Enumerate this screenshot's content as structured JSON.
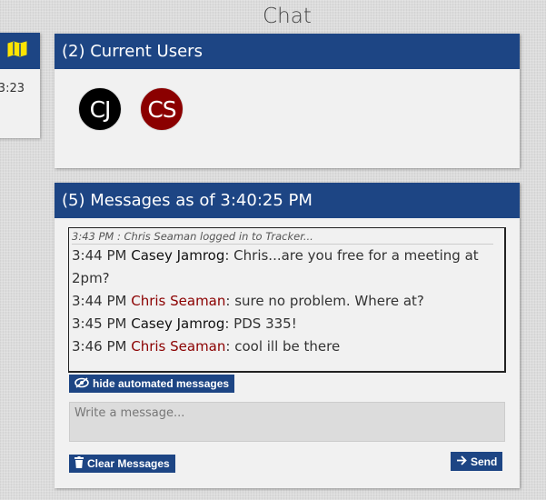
{
  "page": {
    "title": "Chat"
  },
  "left_panel": {
    "time": "3:23",
    "icon": "map-icon"
  },
  "users": {
    "header": "(2) Current Users",
    "list": [
      {
        "initials": "CJ",
        "color": "#000000"
      },
      {
        "initials": "CS",
        "color": "#8b0000"
      }
    ]
  },
  "messages": {
    "header": "(5) Messages as of 3:40:25 PM",
    "automated": "3:43 PM : Chris Seaman logged in to Tracker...",
    "items": [
      {
        "time": "3:44 PM",
        "user": "Casey Jamrog",
        "text": ": Chris...are you free for a meeting at 2pm?",
        "user_color": "#111111"
      },
      {
        "time": "3:44 PM",
        "user": "Chris Seaman",
        "text": ": sure no problem. Where at?",
        "user_color": "#8b0000"
      },
      {
        "time": "3:45 PM",
        "user": "Casey Jamrog",
        "text": ": PDS 335!",
        "user_color": "#111111"
      },
      {
        "time": "3:46 PM",
        "user": "Chris Seaman",
        "text": ": cool ill be there",
        "user_color": "#8b0000"
      }
    ],
    "hide_label": "hide automated messages",
    "input_placeholder": "Write a message...",
    "clear_label": "Clear Messages",
    "send_label": "Send"
  },
  "colors": {
    "accent": "#1d4584",
    "user_red": "#8b0000"
  }
}
